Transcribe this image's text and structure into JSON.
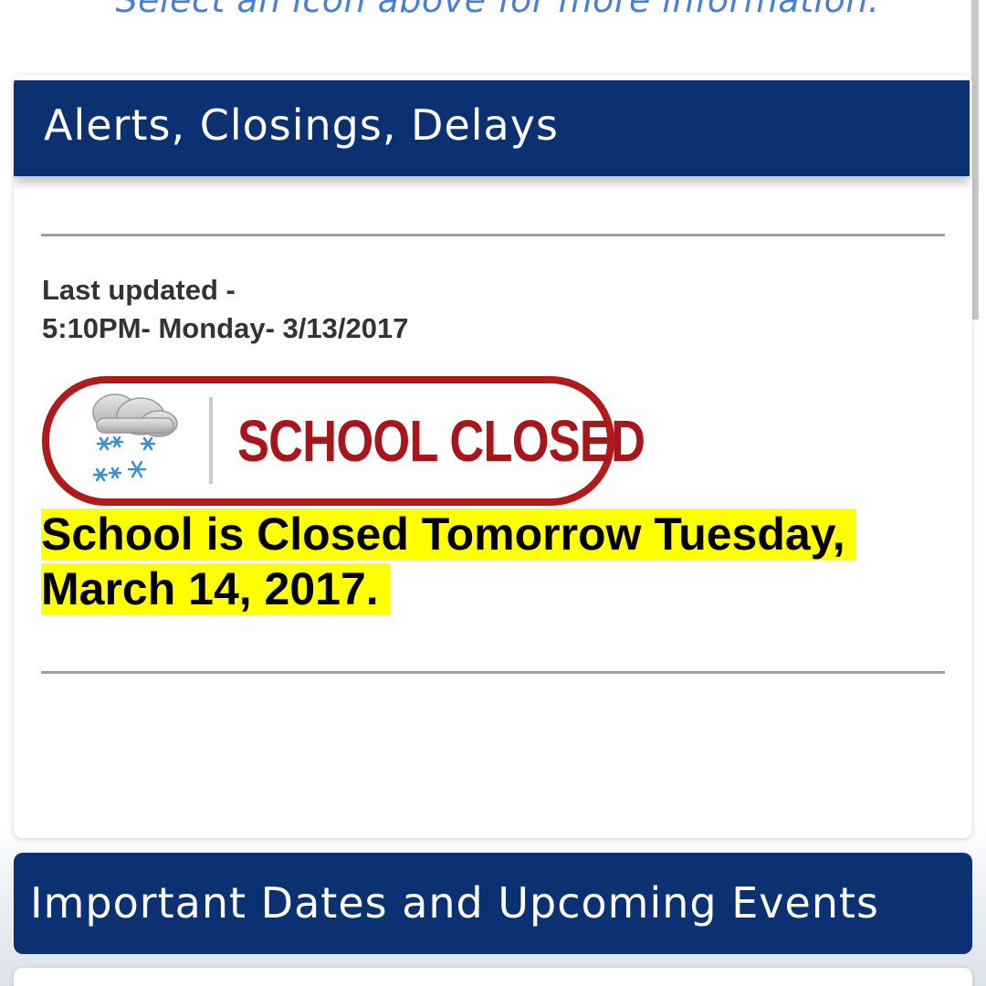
{
  "top_hint": "Select an icon above for more information.",
  "alerts": {
    "title": "Alerts, Closings, Delays",
    "updated_label": "Last updated -",
    "updated_time": "5:10PM- Monday- 3/13/2017",
    "badge_text": "SCHOOL CLOSED",
    "badge_icon": "snow-cloud-icon",
    "announcement_line1": "School is Closed Tomorrow Tuesday,",
    "announcement_line2": "March 14, 2017.",
    "highlight_color": "#ffff00",
    "badge_color": "#b01a18"
  },
  "events": {
    "title": "Important Dates and Upcoming Events"
  },
  "colors": {
    "header_bg": "#0c3172",
    "hint_text": "#4a7fd6"
  }
}
